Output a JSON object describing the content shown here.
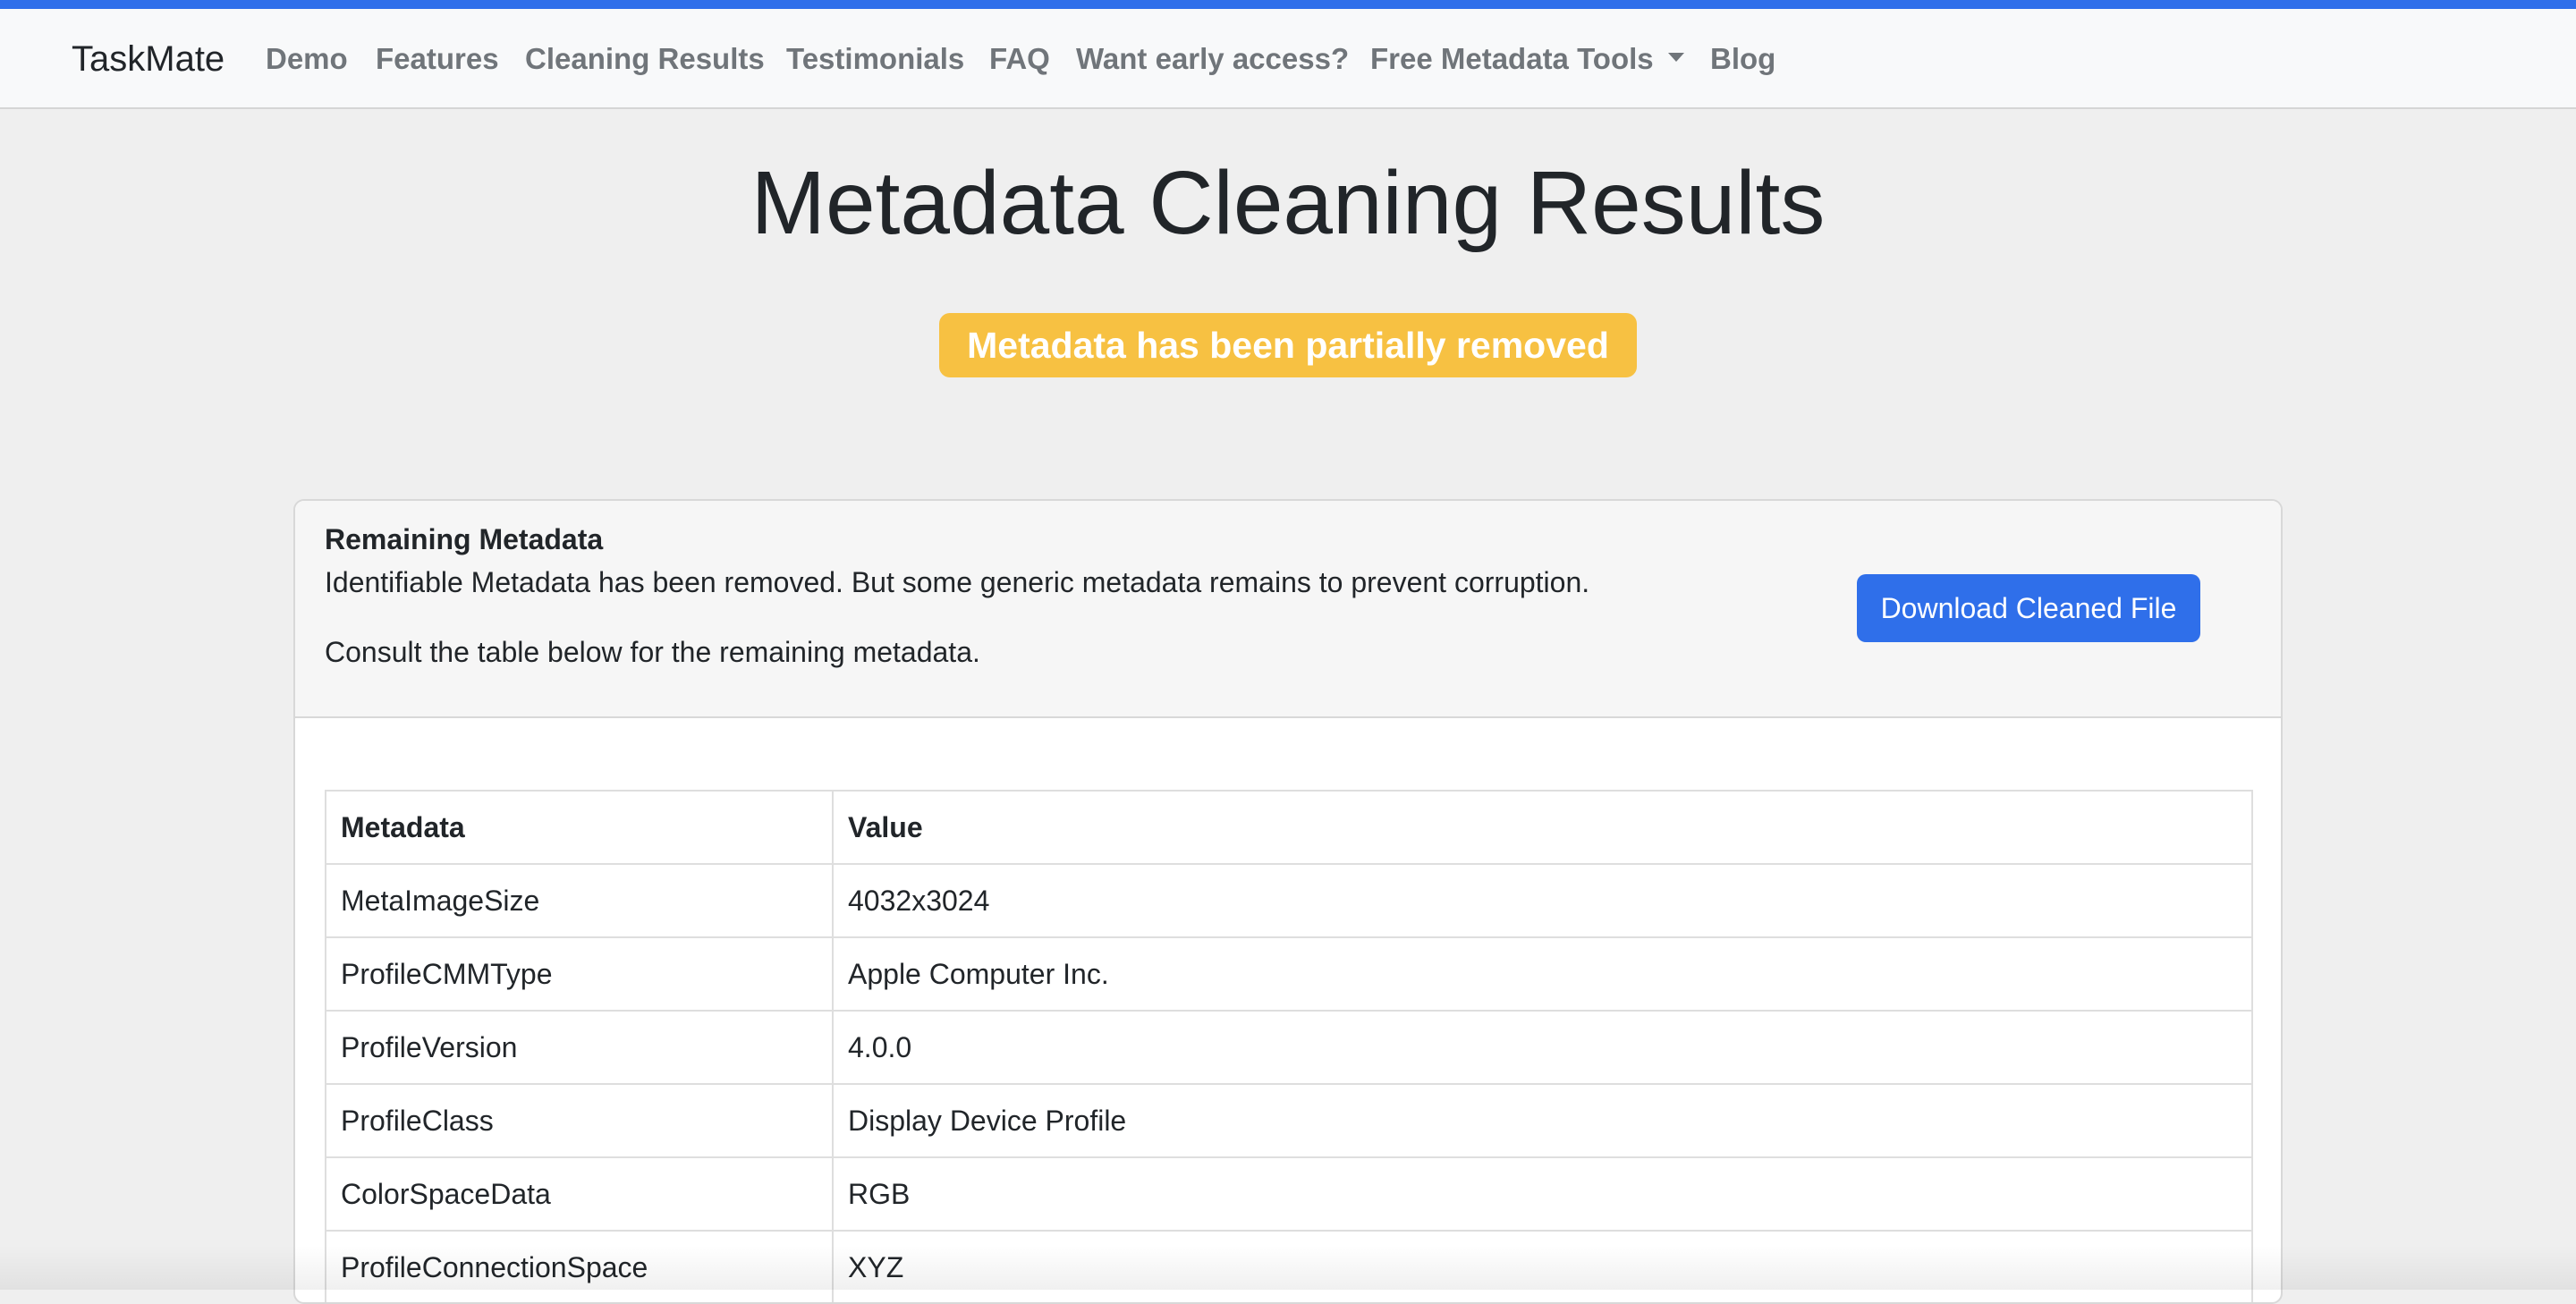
{
  "nav": {
    "brand": "TaskMate",
    "items": [
      {
        "label": "Demo"
      },
      {
        "label": "Features"
      },
      {
        "label": "Cleaning Results"
      },
      {
        "label": "Testimonials"
      },
      {
        "label": "FAQ"
      },
      {
        "label": "Want early access?"
      },
      {
        "label": "Free Metadata Tools",
        "icon": "caret-down-icon"
      },
      {
        "label": "Blog"
      }
    ]
  },
  "main": {
    "title": "Metadata Cleaning Results",
    "status_badge": "Metadata has been partially removed",
    "card": {
      "title": "Remaining Metadata",
      "text_1": "Identifiable Metadata has been removed. But some generic metadata remains to prevent corruption.",
      "text_2": "Consult the table below for the remaining metadata.",
      "download_label": "Download Cleaned File"
    },
    "table": {
      "headers": [
        "Metadata",
        "Value"
      ],
      "rows": [
        [
          "MetaImageSize",
          "4032x3024"
        ],
        [
          "ProfileCMMType",
          "Apple Computer Inc."
        ],
        [
          "ProfileVersion",
          "4.0.0"
        ],
        [
          "ProfileClass",
          "Display Device Profile"
        ],
        [
          "ColorSpaceData",
          "RGB"
        ],
        [
          "ProfileConnectionSpace",
          "XYZ"
        ]
      ]
    }
  },
  "colors": {
    "accent": "#2f6fea",
    "warning": "#f7c142",
    "nav_text": "#70757a"
  }
}
